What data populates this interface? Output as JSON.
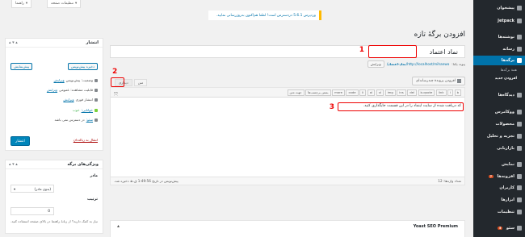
{
  "sidebar": {
    "items": [
      {
        "label": "پیشخوان"
      },
      {
        "label": "Jetpack"
      },
      {
        "label": "نوشته‌ها"
      },
      {
        "label": "رسانه"
      },
      {
        "label": "برگه‌ها"
      },
      {
        "label": "همهٔ برگه‌ها"
      },
      {
        "label": "افزودن جدید"
      },
      {
        "label": "دیدگاه‌ها"
      },
      {
        "label": "ووکامرس"
      },
      {
        "label": "محصولات"
      },
      {
        "label": "تجزیه و تحلیل"
      },
      {
        "label": "بازاریابی"
      },
      {
        "label": "نمایش"
      },
      {
        "label": "افزونه‌ها",
        "badge": "7"
      },
      {
        "label": "کاربران"
      },
      {
        "label": "ابزارها"
      },
      {
        "label": "تنظیمات"
      },
      {
        "label": "سئو",
        "badge": "5"
      }
    ]
  },
  "topbar": {
    "screen_options": "تنظیمات صفحه",
    "help": "راهنما"
  },
  "notice": {
    "text_plain": "وردپرس 5.6.1 دردسترس است!",
    "text_link": "لطفا هم‌اکنون به‌روزرسانی نمایید."
  },
  "page": {
    "heading": "افزودن برگهٔ تازه"
  },
  "editor": {
    "title_value": "نماد اعتماد",
    "permalink_label": "پیوند یکتا:",
    "permalink_url": "http://localhost/mihanwo/",
    "permalink_slug": "نماد-اعتماد/",
    "permalink_edit": "ویرایش",
    "add_media": "افزودن پروندهٔ چندرسانه‌ای",
    "tab_visual": "دیداری",
    "tab_text": "متن",
    "quicktags": [
      "b",
      "i",
      "link",
      "b-quote",
      "del",
      "ins",
      "img",
      "ul",
      "ol",
      "li",
      "code",
      "more",
      "بستن برچسب‌ها",
      "جهت متن"
    ],
    "content": "کد دریافت شده از سایت اینماد را در این قسمت جایگذاری کنید.",
    "word_count": "تعداد واژه‌ها: 12",
    "draft_saved": "پیش‌نویس در تاریخ 1:49:56 ق.ظ ذخیره شد."
  },
  "yoast": {
    "title": "Yoast SEO Premium"
  },
  "publish": {
    "title": "انتشار",
    "save_draft": "ذخیره پیش‌نویس",
    "preview": "پیش‌نمایش",
    "status": "وضعیت: پیش‌نویس",
    "status_edit": "ویرایش",
    "visibility": "قابلیت مشاهده: عمومی",
    "visibility_edit": "ویرایش",
    "schedule": "انتشار فوری",
    "schedule_edit": "ویرایش",
    "readability": "خوانایی:",
    "readability_val": "خوب",
    "seo": "سئو:",
    "seo_val": "در دسترس نمی باشد",
    "trash": "انتقال به زباله‌دان",
    "publish_btn": "انتشار"
  },
  "attributes": {
    "title": "ویژگی‌های برگه",
    "parent_label": "مادر",
    "parent_value": "(بدون مادر)",
    "order_label": "ترتیب",
    "order_value": "0",
    "help": "نیاز به کمک دارید؟ از زبانهٔ راهنما در بالای صفحه استفاده کنید."
  },
  "annotations": {
    "one": "1",
    "two": "2",
    "three": "3",
    "color": "#e00000"
  }
}
